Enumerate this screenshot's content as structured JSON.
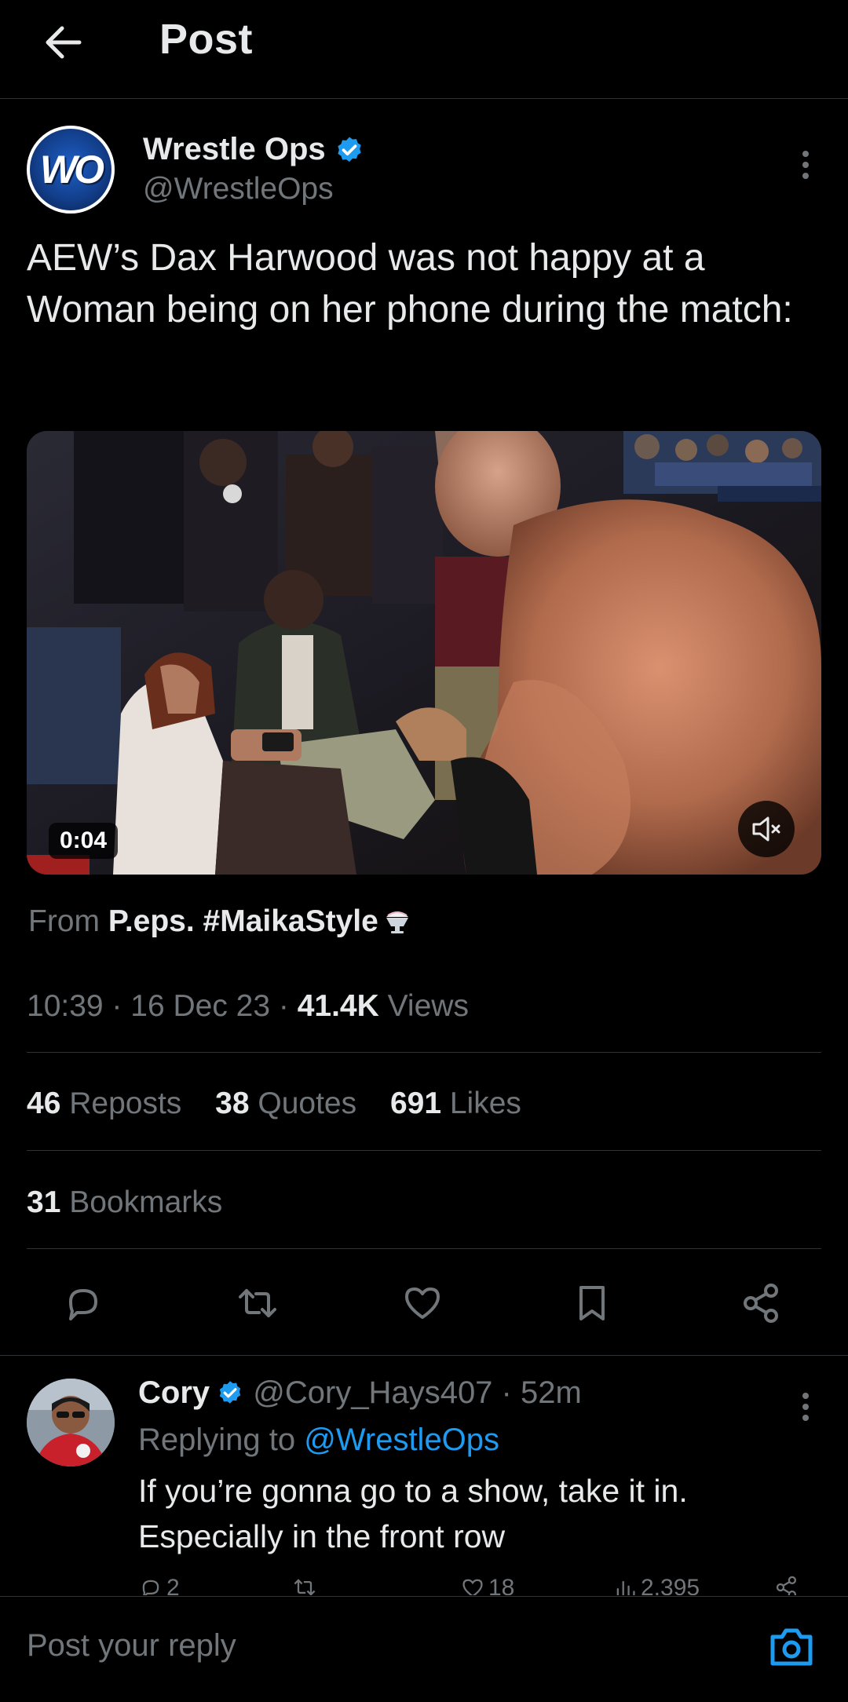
{
  "header": {
    "title": "Post",
    "back_icon": "arrow-left-icon"
  },
  "post": {
    "author": {
      "name": "Wrestle Ops",
      "handle": "@WrestleOps",
      "avatar_text": "WO",
      "verified": true
    },
    "text": "AEW’s Dax Harwood was not happy at a Woman being on her phone during the match:",
    "media": {
      "type": "video",
      "duration": "0:04",
      "muted": true
    },
    "source": {
      "prefix": "From",
      "name": "P.eps. #MaikaStyle"
    },
    "timestamp": "10:39 · 16 Dec 23 · ",
    "views_count": "41.4K",
    "views_label": " Views",
    "stats": {
      "reposts_count": "46",
      "reposts_label": " Reposts",
      "quotes_count": "38",
      "quotes_label": " Quotes",
      "likes_count": "691",
      "likes_label": " Likes",
      "bookmarks_count": "31",
      "bookmarks_label": " Bookmarks"
    }
  },
  "reply": {
    "author_name": "Cory",
    "handle_time": " @Cory_Hays407 · 52m",
    "replying_prefix": "Replying to ",
    "replying_to": "@WrestleOps",
    "text": "If you’re gonna go to a show, take it in. Especially in the front row",
    "reply_count": "2",
    "like_count": "18",
    "view_count": "2,395"
  },
  "composer": {
    "placeholder": "Post your reply"
  },
  "colors": {
    "background": "#000000",
    "text": "#e7e9ea",
    "muted": "#71767b",
    "accent": "#1d9bf0",
    "divider": "#2f3336"
  }
}
